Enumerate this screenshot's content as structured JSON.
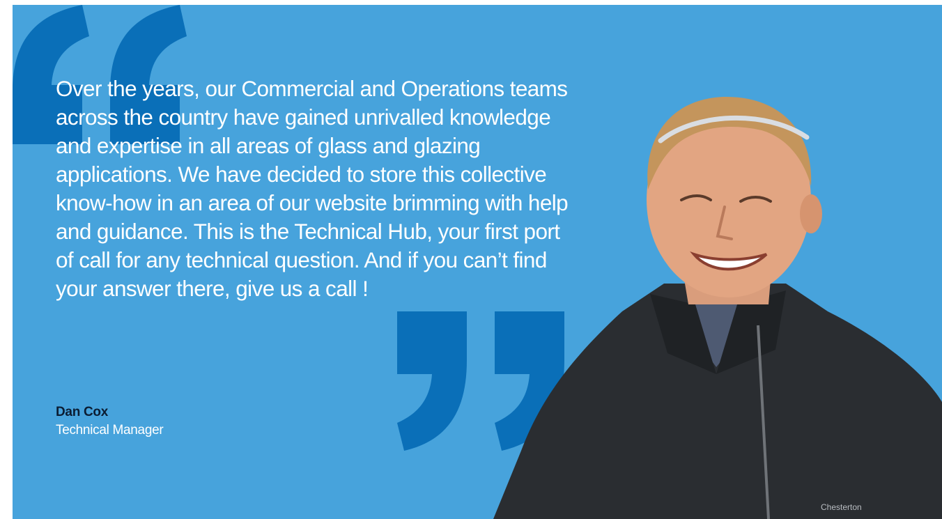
{
  "quote": {
    "text": "Over the years, our Commercial and Operations teams across the country have gained unrivalled knowledge and expertise in all areas of glass and glazing applications. We have decided to store this collective know-how in an area of our website brimming with help and guidance. This is the Technical Hub, your first port of call for any technical question. And if you can’t find your answer there, give us a call !"
  },
  "author": {
    "name": "Dan Cox",
    "role": "Technical Manager"
  },
  "portrait": {
    "jacket_logo_text": "Chesterton"
  },
  "colors": {
    "background": "#47a3dc",
    "quote_mark": "#0a6fb8",
    "quote_text": "#ffffff",
    "author_name": "#0b1d33"
  },
  "icons": {
    "open_quote": "open-quote-mark-icon",
    "close_quote": "close-quote-mark-icon"
  }
}
